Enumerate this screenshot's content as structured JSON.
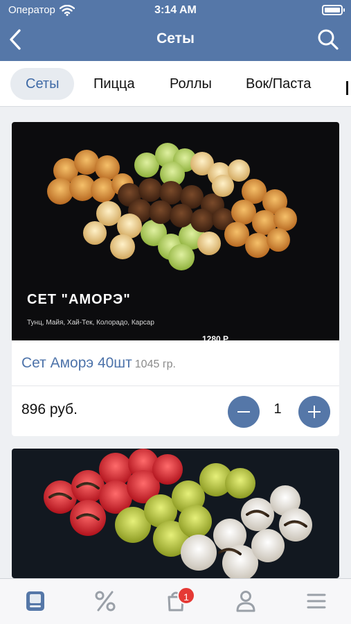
{
  "status": {
    "carrier": "Оператор",
    "time": "3:14 AM"
  },
  "navbar": {
    "title": "Сеты"
  },
  "categories": [
    "Сеты",
    "Пицца",
    "Роллы",
    "Вок/Паста"
  ],
  "products": [
    {
      "image_title": "СЕТ \"АМОРЭ\"",
      "image_subtitle": "Тунц, Майя, Хай-Тек, Колорадо, Карсар",
      "image_price": "1280 Р",
      "name": "Сет Аморэ 40шт",
      "weight": "1045 гр.",
      "price": "896 руб.",
      "quantity": "1"
    }
  ],
  "tabbar": {
    "items": [
      "menu-icon",
      "percent-icon",
      "cart-icon",
      "profile-icon",
      "hamburger-icon"
    ],
    "cart_badge": "1"
  },
  "colors": {
    "accent": "#5577a8",
    "active_tab_text": "#3f6aa6",
    "name_text": "#4d73aa",
    "badge": "#e53935"
  }
}
